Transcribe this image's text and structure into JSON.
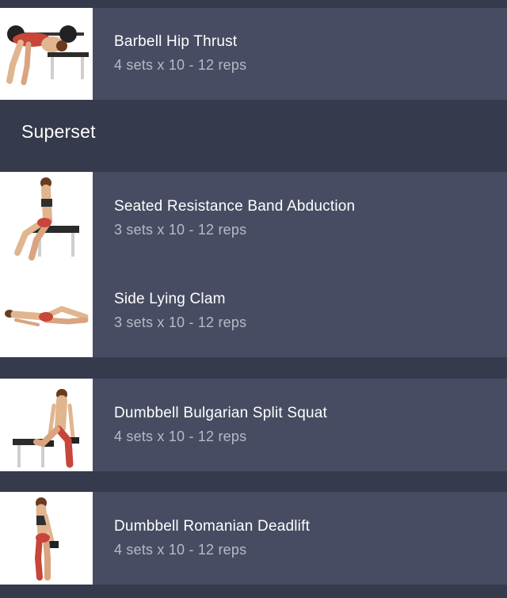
{
  "colors": {
    "background": "#353a4c",
    "card": "#474c62",
    "title_text": "#ffffff",
    "detail_text": "#b6b9c7",
    "muscle_highlight": "#c8453a"
  },
  "section": {
    "title": "Superset"
  },
  "exercises": [
    {
      "name": "Barbell Hip Thrust",
      "detail": "4 sets x 10 - 12 reps",
      "image_icon": "barbell-hip-thrust-illustration"
    },
    {
      "name": "Seated Resistance Band Abduction",
      "detail": "3 sets x 10 - 12 reps",
      "image_icon": "seated-band-abduction-illustration"
    },
    {
      "name": "Side Lying Clam",
      "detail": "3 sets x 10 - 12 reps",
      "image_icon": "side-lying-clam-illustration"
    },
    {
      "name": "Dumbbell Bulgarian Split Squat",
      "detail": "4 sets x 10 - 12 reps",
      "image_icon": "bulgarian-split-squat-illustration"
    },
    {
      "name": "Dumbbell Romanian Deadlift",
      "detail": "4 sets x 10 - 12 reps",
      "image_icon": "romanian-deadlift-illustration"
    }
  ]
}
